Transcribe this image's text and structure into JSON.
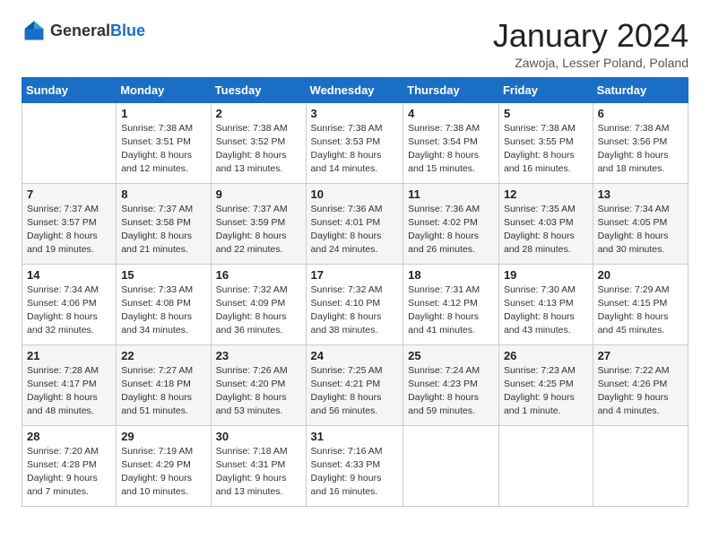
{
  "logo": {
    "general": "General",
    "blue": "Blue"
  },
  "header": {
    "month_year": "January 2024",
    "location": "Zawoja, Lesser Poland, Poland"
  },
  "weekdays": [
    "Sunday",
    "Monday",
    "Tuesday",
    "Wednesday",
    "Thursday",
    "Friday",
    "Saturday"
  ],
  "weeks": [
    [
      {
        "day": "",
        "info": ""
      },
      {
        "day": "1",
        "info": "Sunrise: 7:38 AM\nSunset: 3:51 PM\nDaylight: 8 hours\nand 12 minutes."
      },
      {
        "day": "2",
        "info": "Sunrise: 7:38 AM\nSunset: 3:52 PM\nDaylight: 8 hours\nand 13 minutes."
      },
      {
        "day": "3",
        "info": "Sunrise: 7:38 AM\nSunset: 3:53 PM\nDaylight: 8 hours\nand 14 minutes."
      },
      {
        "day": "4",
        "info": "Sunrise: 7:38 AM\nSunset: 3:54 PM\nDaylight: 8 hours\nand 15 minutes."
      },
      {
        "day": "5",
        "info": "Sunrise: 7:38 AM\nSunset: 3:55 PM\nDaylight: 8 hours\nand 16 minutes."
      },
      {
        "day": "6",
        "info": "Sunrise: 7:38 AM\nSunset: 3:56 PM\nDaylight: 8 hours\nand 18 minutes."
      }
    ],
    [
      {
        "day": "7",
        "info": "Sunrise: 7:37 AM\nSunset: 3:57 PM\nDaylight: 8 hours\nand 19 minutes."
      },
      {
        "day": "8",
        "info": "Sunrise: 7:37 AM\nSunset: 3:58 PM\nDaylight: 8 hours\nand 21 minutes."
      },
      {
        "day": "9",
        "info": "Sunrise: 7:37 AM\nSunset: 3:59 PM\nDaylight: 8 hours\nand 22 minutes."
      },
      {
        "day": "10",
        "info": "Sunrise: 7:36 AM\nSunset: 4:01 PM\nDaylight: 8 hours\nand 24 minutes."
      },
      {
        "day": "11",
        "info": "Sunrise: 7:36 AM\nSunset: 4:02 PM\nDaylight: 8 hours\nand 26 minutes."
      },
      {
        "day": "12",
        "info": "Sunrise: 7:35 AM\nSunset: 4:03 PM\nDaylight: 8 hours\nand 28 minutes."
      },
      {
        "day": "13",
        "info": "Sunrise: 7:34 AM\nSunset: 4:05 PM\nDaylight: 8 hours\nand 30 minutes."
      }
    ],
    [
      {
        "day": "14",
        "info": "Sunrise: 7:34 AM\nSunset: 4:06 PM\nDaylight: 8 hours\nand 32 minutes."
      },
      {
        "day": "15",
        "info": "Sunrise: 7:33 AM\nSunset: 4:08 PM\nDaylight: 8 hours\nand 34 minutes."
      },
      {
        "day": "16",
        "info": "Sunrise: 7:32 AM\nSunset: 4:09 PM\nDaylight: 8 hours\nand 36 minutes."
      },
      {
        "day": "17",
        "info": "Sunrise: 7:32 AM\nSunset: 4:10 PM\nDaylight: 8 hours\nand 38 minutes."
      },
      {
        "day": "18",
        "info": "Sunrise: 7:31 AM\nSunset: 4:12 PM\nDaylight: 8 hours\nand 41 minutes."
      },
      {
        "day": "19",
        "info": "Sunrise: 7:30 AM\nSunset: 4:13 PM\nDaylight: 8 hours\nand 43 minutes."
      },
      {
        "day": "20",
        "info": "Sunrise: 7:29 AM\nSunset: 4:15 PM\nDaylight: 8 hours\nand 45 minutes."
      }
    ],
    [
      {
        "day": "21",
        "info": "Sunrise: 7:28 AM\nSunset: 4:17 PM\nDaylight: 8 hours\nand 48 minutes."
      },
      {
        "day": "22",
        "info": "Sunrise: 7:27 AM\nSunset: 4:18 PM\nDaylight: 8 hours\nand 51 minutes."
      },
      {
        "day": "23",
        "info": "Sunrise: 7:26 AM\nSunset: 4:20 PM\nDaylight: 8 hours\nand 53 minutes."
      },
      {
        "day": "24",
        "info": "Sunrise: 7:25 AM\nSunset: 4:21 PM\nDaylight: 8 hours\nand 56 minutes."
      },
      {
        "day": "25",
        "info": "Sunrise: 7:24 AM\nSunset: 4:23 PM\nDaylight: 8 hours\nand 59 minutes."
      },
      {
        "day": "26",
        "info": "Sunrise: 7:23 AM\nSunset: 4:25 PM\nDaylight: 9 hours\nand 1 minute."
      },
      {
        "day": "27",
        "info": "Sunrise: 7:22 AM\nSunset: 4:26 PM\nDaylight: 9 hours\nand 4 minutes."
      }
    ],
    [
      {
        "day": "28",
        "info": "Sunrise: 7:20 AM\nSunset: 4:28 PM\nDaylight: 9 hours\nand 7 minutes."
      },
      {
        "day": "29",
        "info": "Sunrise: 7:19 AM\nSunset: 4:29 PM\nDaylight: 9 hours\nand 10 minutes."
      },
      {
        "day": "30",
        "info": "Sunrise: 7:18 AM\nSunset: 4:31 PM\nDaylight: 9 hours\nand 13 minutes."
      },
      {
        "day": "31",
        "info": "Sunrise: 7:16 AM\nSunset: 4:33 PM\nDaylight: 9 hours\nand 16 minutes."
      },
      {
        "day": "",
        "info": ""
      },
      {
        "day": "",
        "info": ""
      },
      {
        "day": "",
        "info": ""
      }
    ]
  ]
}
